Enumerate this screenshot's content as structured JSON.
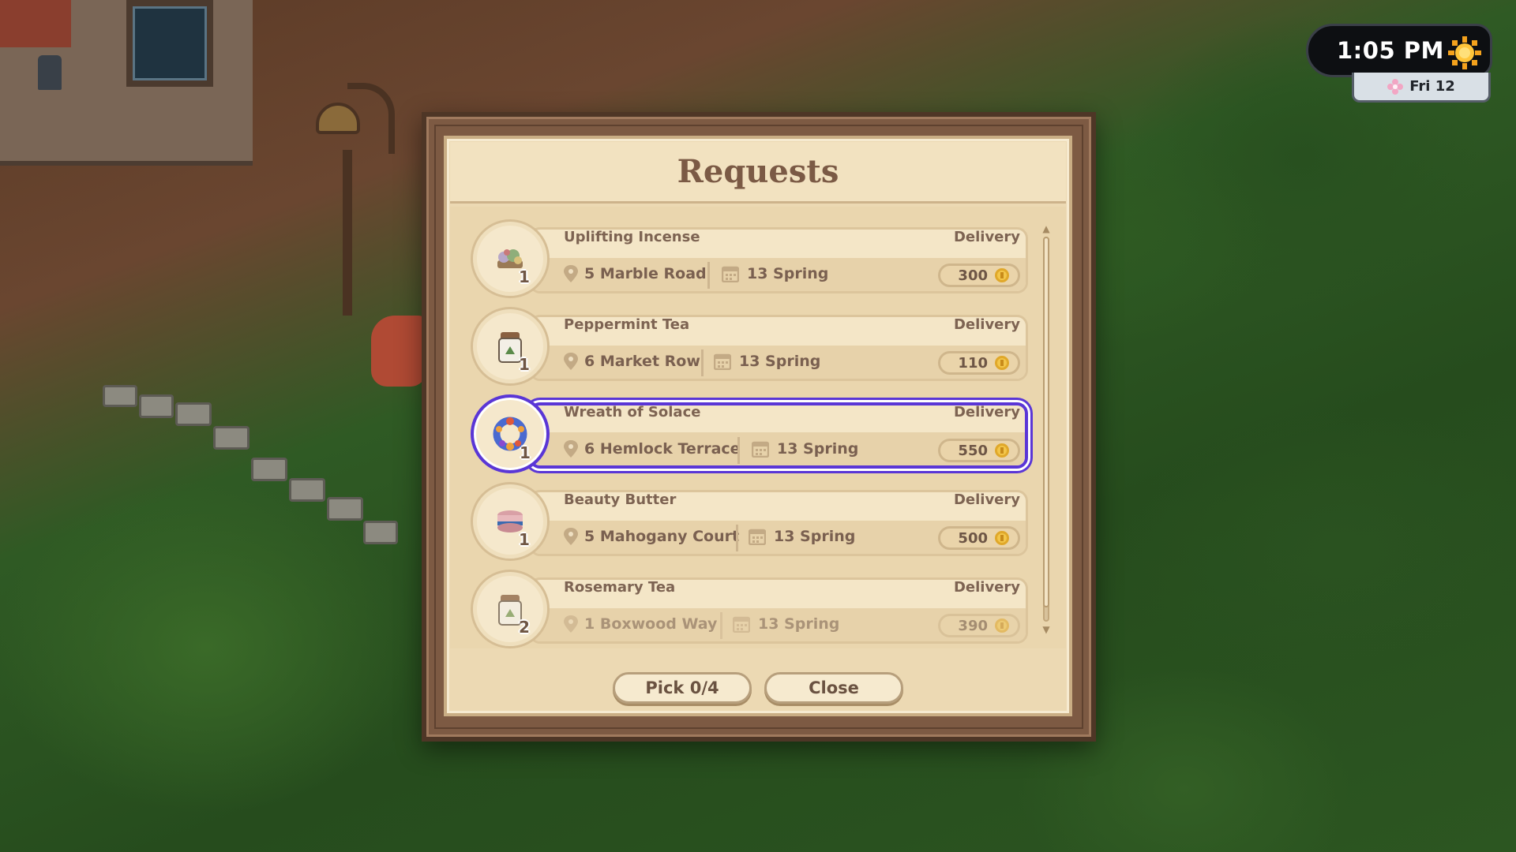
{
  "hud": {
    "time": "1:05 PM",
    "weather_icon": "sun-icon",
    "date": "Fri 12",
    "season_icon": "flower-icon"
  },
  "dialog": {
    "title": "Requests",
    "requests": [
      {
        "name": "Uplifting Incense",
        "type": "Delivery",
        "location": "5 Marble Road",
        "due": "13 Spring",
        "reward": "300",
        "quantity": "1",
        "icon": "incense-icon"
      },
      {
        "name": "Peppermint Tea",
        "type": "Delivery",
        "location": "6 Market Row",
        "due": "13 Spring",
        "reward": "110",
        "quantity": "1",
        "icon": "tea-jar-icon"
      },
      {
        "name": "Wreath of Solace",
        "type": "Delivery",
        "location": "6 Hemlock Terrace",
        "due": "13 Spring",
        "reward": "550",
        "quantity": "1",
        "icon": "wreath-icon",
        "selected": true
      },
      {
        "name": "Beauty Butter",
        "type": "Delivery",
        "location": "5 Mahogany Court",
        "due": "13 Spring",
        "reward": "500",
        "quantity": "1",
        "icon": "butter-jar-icon"
      },
      {
        "name": "Rosemary Tea",
        "type": "Delivery",
        "location": "1 Boxwood Way",
        "due": "13 Spring",
        "reward": "390",
        "quantity": "2",
        "icon": "tea-jar-icon"
      }
    ],
    "buttons": {
      "pick": "Pick 0/4",
      "close": "Close"
    }
  },
  "colors": {
    "selection": "#5a36d6",
    "paper": "#ecd9b3",
    "frame": "#7d5a43",
    "text": "#7d6352"
  }
}
